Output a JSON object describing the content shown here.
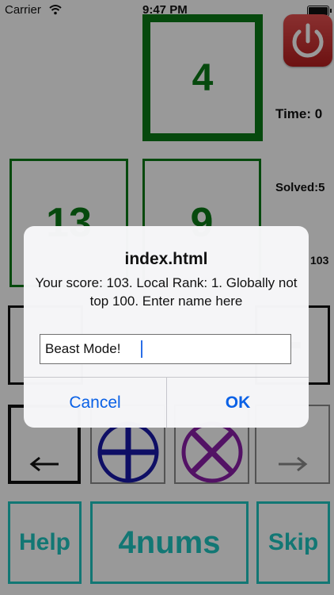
{
  "status_bar": {
    "carrier": "Carrier",
    "time": "9:47 PM"
  },
  "game": {
    "target_tile": "4",
    "number_tiles": [
      "13",
      "9"
    ],
    "side": {
      "time": "Time: 0",
      "solved": "Solved:5",
      "score": "103"
    },
    "bottom": {
      "help": "Help",
      "title": "4nums",
      "skip": "Skip"
    }
  },
  "dialog": {
    "title": "index.html",
    "message": "Your score: 103. Local Rank: 1. Globally not top 100. Enter name here",
    "input_value": "Beast Mode!",
    "cancel_label": "Cancel",
    "ok_label": "OK"
  },
  "colors": {
    "tile_green": "#0b7a16",
    "accent_teal": "#1fc7c1",
    "button_blue": "#0a61e6",
    "power_red": "#d02a2a"
  }
}
